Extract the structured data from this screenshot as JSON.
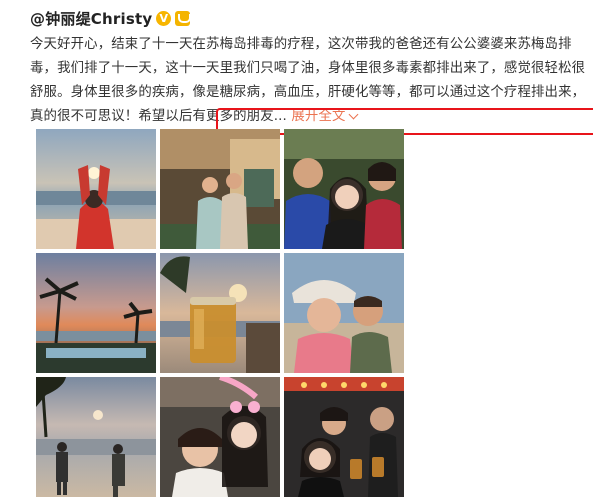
{
  "post": {
    "author": "@钟丽缇Christy",
    "verified_badge": "V",
    "lines": [
      "今天好开心，结束了十一天在苏梅岛排毒的疗程，这次带我的爸爸还有公公婆婆来苏梅岛排",
      "毒，我们排了十一天，这十一天里我们只喝了油，身体里很多毒素都排出来了，感觉很轻松很",
      "舒服。身体里很多的疾病，像是糖尿病，高血压，肝硬化等等，都可以通过这个疗程排出来，",
      "真的很不可思议！希望以后有更多的朋友..."
    ],
    "expand_label": "展开全文",
    "highlight_color": "#e8141a",
    "accent_color": "#eb7350"
  },
  "photos": [
    {
      "name": "sunset-heart-hands-photo"
    },
    {
      "name": "two-men-posing-photo"
    },
    {
      "name": "family-selfie-photo"
    },
    {
      "name": "palm-sunset-pool-photo"
    },
    {
      "name": "oil-jar-beach-photo"
    },
    {
      "name": "couple-selfie-photo"
    },
    {
      "name": "two-people-sunset-beach-photo"
    },
    {
      "name": "filtered-selfie-photo"
    },
    {
      "name": "group-toast-photo"
    }
  ]
}
